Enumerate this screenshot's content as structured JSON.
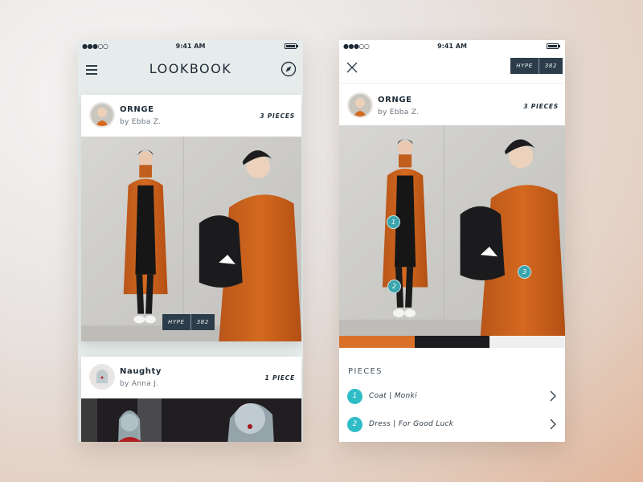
{
  "colors": {
    "accent_teal": "#2fbcc6",
    "pin_teal": "#3aa5ad",
    "navy": "#1e2b36",
    "coat_orange": "#d4691f",
    "strip": [
      "#d9702a",
      "#1c1c1e",
      "#efefef"
    ]
  },
  "left_screen": {
    "status": {
      "signal": "●●●○○",
      "time": "9:41 AM"
    },
    "header": {
      "title": "LOOKBOOK",
      "menu_icon": "hamburger-icon",
      "nav_icon": "compass-icon"
    },
    "cards": [
      {
        "title": "ORNGE",
        "author": "by Ebba Z.",
        "pieces": "3 PIECES",
        "hype_label": "HYPE",
        "hype_count": "382"
      },
      {
        "title": "Naughty",
        "author": "by Anna J.",
        "pieces": "1 PIECE"
      }
    ]
  },
  "right_screen": {
    "status": {
      "signal": "●●●○○",
      "time": "9:41 AM"
    },
    "header": {
      "close_icon": "close-icon",
      "hype_label": "HYPE",
      "hype_count": "382"
    },
    "look": {
      "title": "ORNGE",
      "author": "by Ebba Z.",
      "pieces": "3 PIECES"
    },
    "pins": [
      "1",
      "2",
      "3"
    ],
    "pieces_heading": "PIECES",
    "pieces": [
      {
        "num": "1",
        "name": "Coat | Monki"
      },
      {
        "num": "2",
        "name": "Dress | For Good Luck"
      }
    ]
  }
}
